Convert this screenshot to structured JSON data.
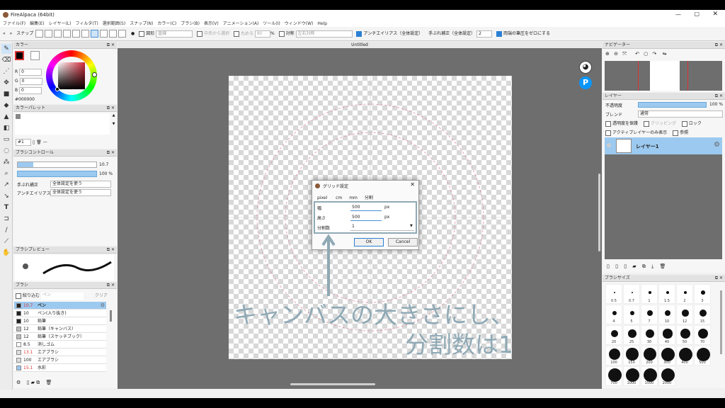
{
  "app": {
    "title": "FireAlpaca (64bit)"
  },
  "menu": [
    "ファイル(F)",
    "編集(E)",
    "レイヤー(L)",
    "フィルタ(T)",
    "選択範囲(S)",
    "スナップ(N)",
    "カラー(C)",
    "ブラシ(B)",
    "表示(V)",
    "アニメーション(A)",
    "ツール(I)",
    "ウィンドウ(W)",
    "Help"
  ],
  "toolbar": {
    "snap_label": "スナップ",
    "shape_label": "図形",
    "shape_value": "直線",
    "center_select": "中央から選択",
    "round": "丸める",
    "round_value": "80",
    "round_unit": "%",
    "symmetry": "対称",
    "symmetry_value": "左右対称",
    "antialias": "アンチエイリアス（全体設定）",
    "stabilizer": "手ぶれ補正（全体設定）",
    "stabilizer_value": "2",
    "pressure": "両端の筆圧をゼロにする"
  },
  "color_panel": {
    "title": "カラー",
    "r_label": "R",
    "r_value": "0",
    "g_label": "G",
    "g_value": "0",
    "b_label": "B",
    "b_value": "0",
    "hex": "#000000",
    "current_color": "#000000"
  },
  "palette_panel": {
    "title": "カラーパレット",
    "index": "#1"
  },
  "brush_control": {
    "title": "ブラシコントロール",
    "size_value": "10.7",
    "opacity_value": "100 %",
    "stabilizer_label": "手ぶれ補正",
    "stabilizer_value": "全体設定を使う",
    "antialias_label": "アンチエイリアス",
    "antialias_value": "全体設定を使う"
  },
  "brush_preview": {
    "title": "ブラシプレビュー"
  },
  "brush_panel": {
    "title": "ブラシ",
    "filter_label": "絞り込む",
    "filter_placeholder": "ペン",
    "clear_label": "クリア",
    "items": [
      {
        "size": "10.7",
        "name": "ペン",
        "swatch": "#222222",
        "selected": true,
        "red": true
      },
      {
        "size": "10",
        "name": "ペン(入り抜き)",
        "swatch": "#222222"
      },
      {
        "size": "10",
        "name": "鉛筆",
        "swatch": "#222222"
      },
      {
        "size": "12",
        "name": "鉛筆（キャンバス）",
        "swatch": "#bbbbbb"
      },
      {
        "size": "12",
        "name": "鉛筆（スケッチブック）",
        "swatch": "#bbbbbb"
      },
      {
        "size": "8.5",
        "name": "消しゴム",
        "swatch": "#ffffff"
      },
      {
        "size": "13.1",
        "name": "エアブラシ",
        "swatch": "#dddddd",
        "red": true
      },
      {
        "size": "100",
        "name": "エアブラシ",
        "swatch": "#dddddd"
      },
      {
        "size": "15.1",
        "name": "水彩",
        "swatch": "#9cc9ef",
        "red": true
      }
    ]
  },
  "canvas": {
    "tab_title": "Untitled"
  },
  "grid_dialog": {
    "title": "グリッド設定",
    "tabs": [
      "pixel",
      "cm",
      "mm",
      "分割"
    ],
    "width_label": "幅",
    "width_value": "500",
    "height_label": "高さ",
    "height_value": "500",
    "unit": "px",
    "divisions_label": "分割数",
    "divisions_value": "1",
    "ok": "OK",
    "cancel": "Cancel"
  },
  "annotation": {
    "line1": "キャンバスの大きさにし、",
    "line2": "分割数は1",
    "color": "#8fa9b5"
  },
  "navigator": {
    "title": "ナビゲーター"
  },
  "layer_panel": {
    "title": "レイヤー",
    "opacity_label": "不透明度",
    "opacity_value": "100 %",
    "blend_label": "ブレンド",
    "blend_value": "通常",
    "protect_alpha": "透明度を保護",
    "clipping": "クリッピング",
    "lock": "ロック",
    "active_only": "アクティブレイヤーのみ表示",
    "reference": "参照",
    "layer_name": "レイヤー1"
  },
  "brush_size_panel": {
    "title": "ブラシサイズ",
    "sizes": [
      "0.5",
      "0.7",
      "1",
      "1.5",
      "2",
      "3",
      "4",
      "5",
      "7",
      "10",
      "12",
      "15",
      "20",
      "25",
      "30",
      "40",
      "50",
      "70",
      "100",
      "150",
      "200",
      "300",
      "400",
      "500",
      "700",
      "1000",
      "1500",
      "2000"
    ]
  }
}
